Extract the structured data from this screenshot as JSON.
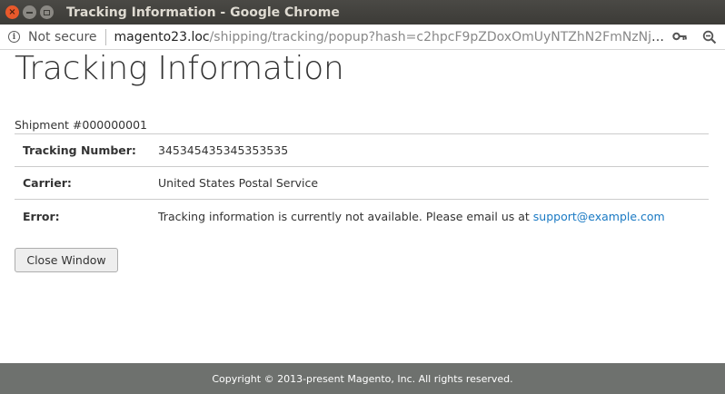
{
  "window": {
    "title": "Tracking Information - Google Chrome",
    "close_glyph": "×",
    "min_glyph": "",
    "max_glyph": ""
  },
  "addressbar": {
    "info_glyph": "i",
    "security_label": "Not secure",
    "url_host": "magento23.loc",
    "url_path": "/shipping/tracking/popup?hash=c2hpcF9pZDoxOmUyNTZhN2FmNzNjMmM1O..."
  },
  "page": {
    "title": "Tracking Information",
    "shipment": "Shipment #000000001",
    "rows": [
      {
        "label": "Tracking Number:",
        "value": "345345435345353535"
      },
      {
        "label": "Carrier:",
        "value": "United States Postal Service"
      },
      {
        "label": "Error:",
        "value": "Tracking information is currently not available. Please email us at ",
        "link": "support@example.com"
      }
    ],
    "close_button": "Close Window"
  },
  "footer": {
    "copyright": "Copyright © 2013-present Magento, Inc. All rights reserved."
  },
  "colors": {
    "link": "#1979c3",
    "footer_bg": "#6e716e",
    "titlebar_bg": "#3c3b37",
    "close_button_accent": "#e9592b"
  }
}
